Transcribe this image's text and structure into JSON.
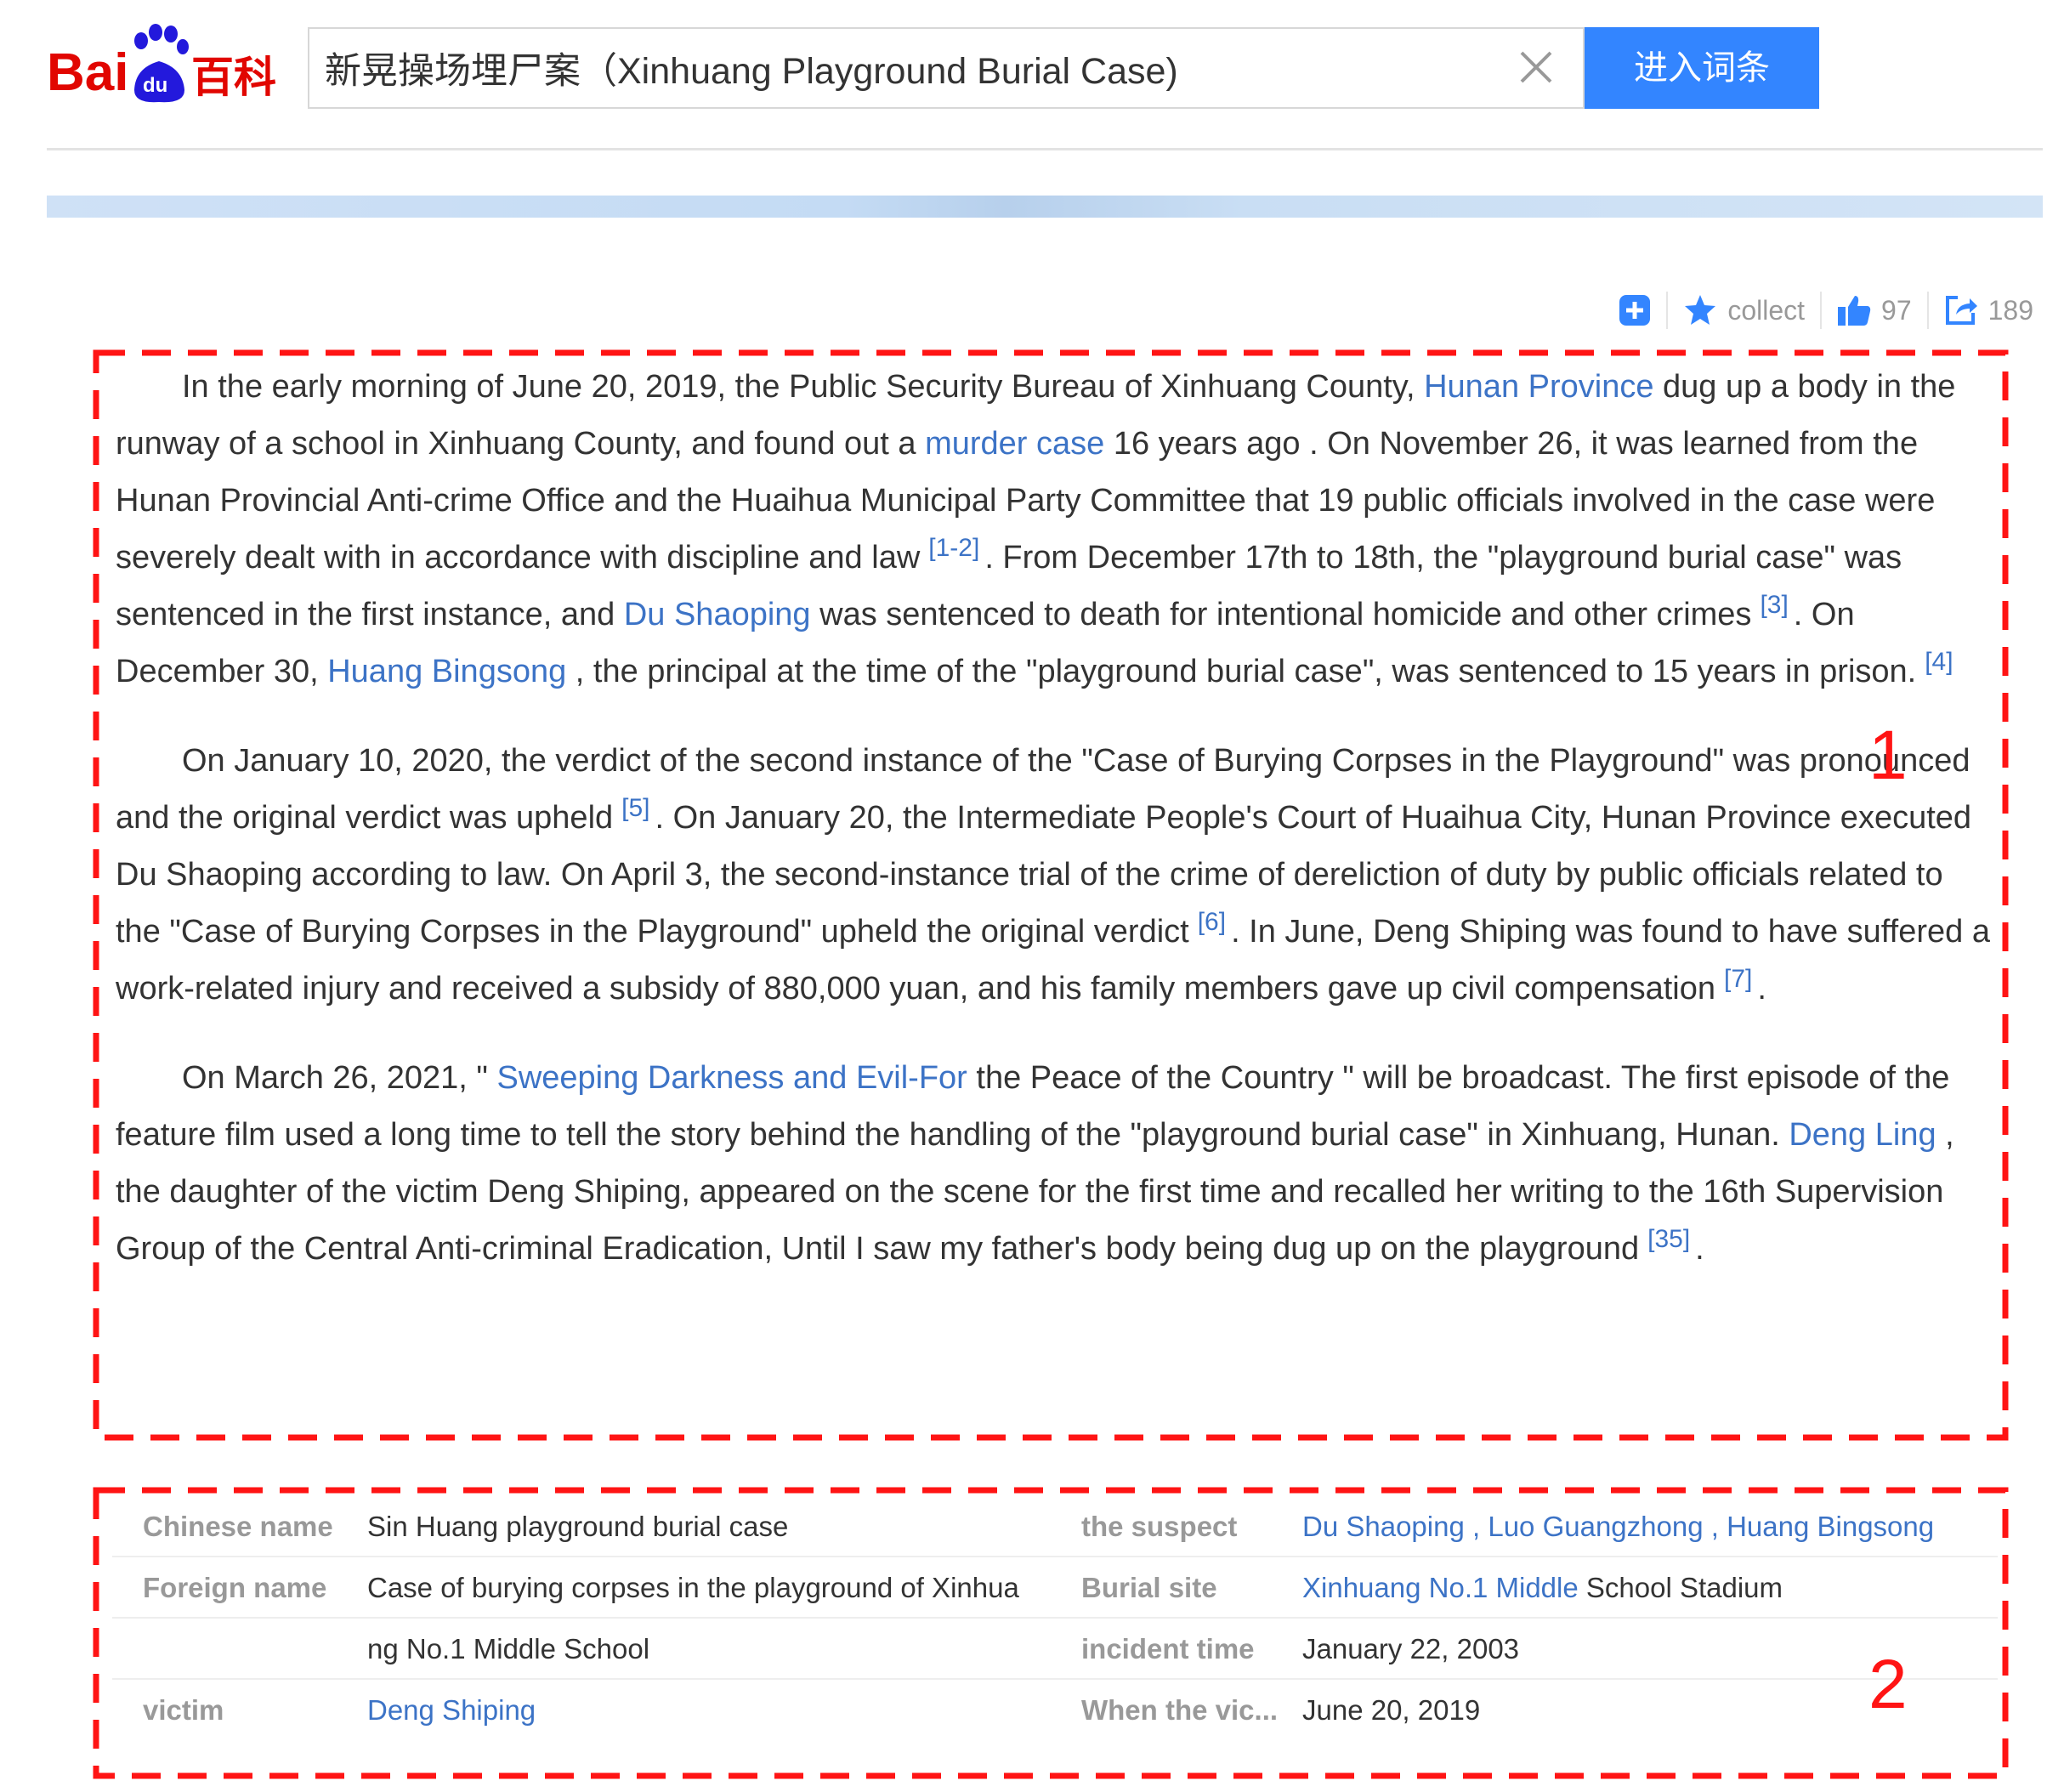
{
  "header": {
    "logo_text_left": "Bai",
    "logo_text_du": "du",
    "logo_text_right": "百科",
    "search_value": "新晃操场埋尸案（Xinhuang Playground Burial Case)",
    "enter_button_label": "进入词条",
    "colors": {
      "logo_red": "#e10601",
      "logo_blue": "#2319dc",
      "button_blue": "#3385ff"
    }
  },
  "toolbar": {
    "collect_label": "collect",
    "like_count": "97",
    "share_count": "189",
    "icons": [
      "add-icon",
      "star-icon",
      "thumbs-up-icon",
      "share-icon"
    ]
  },
  "annotations": {
    "box1_number": "1",
    "box2_number": "2",
    "box_color": "#ff1414"
  },
  "summary": {
    "p1": {
      "t1": "In the early morning of June 20, 2019, the Public Security Bureau of Xinhuang County, ",
      "link1": "Hunan Province",
      "t2": " dug up a body in the runway of a school in Xinhuang County, and found out a ",
      "link2": "murder case",
      "t3": " 16 years ago . On November 26, it was learned from the Hunan Provincial Anti-crime Office and the Huaihua Municipal Party Committee that 19 public officials involved in the case were severely dealt with in accordance with discipline and law",
      "ref1": "[1-2]",
      "t4": ". From December 17th to 18th, the \"playground burial case\" was sentenced in the first instance, and ",
      "link3": "Du Shaoping",
      "t5": " was sentenced to death for intentional homicide and other crimes",
      "ref2": "[3]",
      "t6": ". On December 30, ",
      "link4": "Huang Bingsong",
      "t7": " , the principal at the time of the \"playground burial case\", was sentenced to 15 years in prison.",
      "ref3": "[4]"
    },
    "p2": {
      "t1": "On January 10, 2020, the verdict of the second instance of the \"Case of Burying Corpses in the Playground\" was pronounced and the original verdict was upheld",
      "ref1": "[5]",
      "t2": ". On January 20, the Intermediate People's Court of Huaihua City, Hunan Province executed Du Shaoping according to law. On April 3, the second-instance trial of the crime of dereliction of duty by public officials related to the \"Case of Burying Corpses in the Playground\" upheld the original verdict",
      "ref2": "[6]",
      "t3": ". In June, Deng Shiping was found to have suffered a work-related injury and received a subsidy of 880,000 yuan, and his family members gave up civil compensation",
      "ref3": "[7]",
      "t4": "."
    },
    "p3": {
      "t1": "On March 26, 2021, \" ",
      "link1": "Sweeping Darkness and Evil-For",
      "t2": " the Peace of the Country \" will be broadcast. The first episode of the feature film used a long time to tell the story behind the handling of the \"playground burial case\" in Xinhuang, Hunan. ",
      "link2": "Deng Ling",
      "t3": " , the daughter of the victim Deng Shiping, appeared on the scene for the first time and recalled her writing to the 16th Supervision Group of the Central Anti-criminal Eradication, Until I saw my father's body being dug up on the playground",
      "ref1": "[35]",
      "t4": "."
    }
  },
  "info": {
    "rows": [
      {
        "k1": "Chinese name",
        "v1": "Sin Huang playground burial case",
        "k2": "the suspect",
        "v2_link1": "Du Shaoping",
        "v2_sep1": " , ",
        "v2_link2": "Luo Guangzhong",
        "v2_sep2": " , ",
        "v2_link3": "Huang Bingsong"
      },
      {
        "k1": "Foreign name",
        "v1": "Case of burying corpses in the playground of Xinhua",
        "k2": "Burial site",
        "v2_link": "Xinhuang No.1 Middle",
        "v2_text": " School Stadium"
      },
      {
        "k1": "",
        "v1": "ng No.1 Middle School",
        "k2": "incident time",
        "v2": "January 22, 2003"
      },
      {
        "k1": "victim",
        "v1_link": "Deng Shiping",
        "k2": "When the vic...",
        "v2": "June 20, 2019"
      }
    ]
  }
}
